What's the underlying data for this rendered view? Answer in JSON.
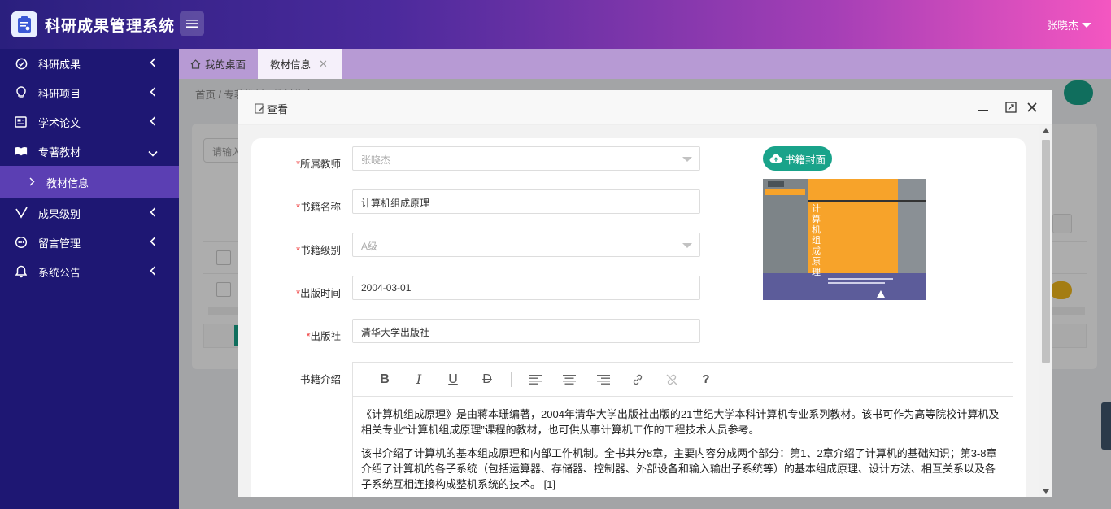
{
  "app": {
    "title": "科研成果管理系统",
    "user_name": "张晓杰"
  },
  "sidebar": {
    "items": [
      {
        "label": "科研成果",
        "icon": "check-circle-icon"
      },
      {
        "label": "科研项目",
        "icon": "lightbulb-icon"
      },
      {
        "label": "学术论文",
        "icon": "newspaper-icon"
      },
      {
        "label": "专著教材",
        "icon": "book-open-icon",
        "expanded": true
      },
      {
        "label": "成果级别",
        "icon": "check-badge-icon"
      },
      {
        "label": "留言管理",
        "icon": "comment-icon"
      },
      {
        "label": "系统公告",
        "icon": "bell-icon"
      }
    ],
    "sub_item": {
      "label": "教材信息",
      "active": true
    }
  },
  "tabs": {
    "home": "我的桌面",
    "active": "教材信息"
  },
  "background": {
    "breadcrumb": "首页  /  专著教材  /  教材信息",
    "search_placeholder": "请输入"
  },
  "modal": {
    "title": "查看",
    "fields": {
      "teacher_label": "所属教师",
      "teacher_value": "张晓杰",
      "book_name_label": "书籍名称",
      "book_name_value": "计算机组成原理",
      "book_level_label": "书籍级别",
      "book_level_value": "A级",
      "publish_date_label": "出版时间",
      "publish_date_value": "2004-03-01",
      "publisher_label": "出版社",
      "publisher_value": "清华大学出版社",
      "intro_label": "书籍介绍",
      "required_mark": "*"
    },
    "cover_button": "书籍封面",
    "cover": {
      "vertical_title": [
        "计",
        "算",
        "机",
        "组",
        "成",
        "原",
        "理"
      ],
      "colors": {
        "orange": "#f7a32a",
        "gray": "#8a9095",
        "purple": "#5c5c9a"
      }
    },
    "editor": {
      "toolbar": [
        "B",
        "I",
        "U",
        "D",
        "align-left",
        "align-center",
        "align-right",
        "link",
        "unlink",
        "?"
      ],
      "paragraphs": [
        "《计算机组成原理》是由蒋本珊编著，2004年清华大学出版社出版的21世纪大学本科计算机专业系列教材。该书可作为高等院校计算机及相关专业“计算机组成原理”课程的教材，也可供从事计算机工作的工程技术人员参考。",
        "该书介绍了计算机的基本组成原理和内部工作机制。全书共分8章，主要内容分成两个部分：第1、2章介绍了计算机的基础知识；第3-8章介绍了计算机的各子系统（包括运算器、存储器、控制器、外部设备和输入输出子系统等）的基本组成原理、设计方法、相互关系以及各子系统互相连接构成整机系统的技术。 [1]"
      ]
    }
  },
  "colors": {
    "sidebar_bg": "#1e1773",
    "sidebar_active": "#5b3fb3",
    "accent_green": "#19a38a",
    "header_gradient_start": "#2a1f7e",
    "header_gradient_end": "#f456c1"
  }
}
